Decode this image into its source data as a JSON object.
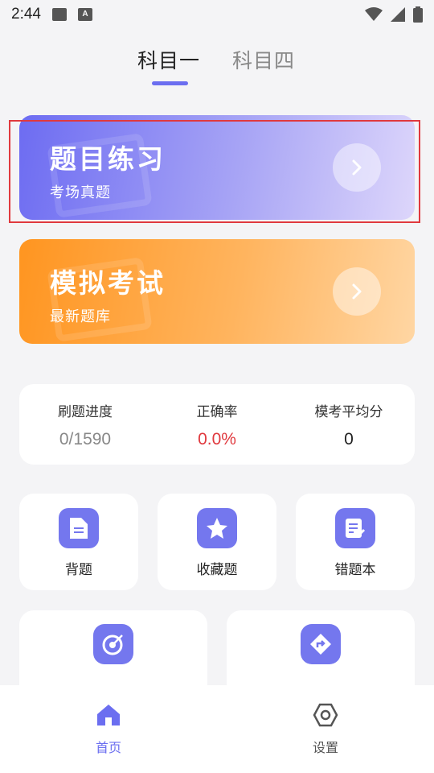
{
  "status_bar": {
    "time": "2:44"
  },
  "subject_tabs": [
    {
      "label": "科目一",
      "active": true
    },
    {
      "label": "科目四",
      "active": false
    }
  ],
  "practice_card": {
    "title": "题目练习",
    "subtitle": "考场真题"
  },
  "mock_card": {
    "title": "模拟考试",
    "subtitle": "最新题库"
  },
  "stats": [
    {
      "label": "刷题进度",
      "value": "0/1590",
      "color": "#888888"
    },
    {
      "label": "正确率",
      "value": "0.0%",
      "color": "#e0393e"
    },
    {
      "label": "模考平均分",
      "value": "0",
      "color": "#222222"
    }
  ],
  "features": [
    {
      "label": "背题",
      "icon": "document-icon"
    },
    {
      "label": "收藏题",
      "icon": "star-icon"
    },
    {
      "label": "错题本",
      "icon": "edit-list-icon"
    }
  ],
  "extra_features": [
    {
      "icon": "target-icon"
    },
    {
      "icon": "turn-right-sign-icon"
    }
  ],
  "bottom_nav": [
    {
      "label": "首页",
      "icon": "home-icon",
      "active": true
    },
    {
      "label": "设置",
      "icon": "settings-hex-icon",
      "active": false
    }
  ],
  "colors": {
    "accent": "#6b6ef0",
    "practice_gradient_start": "#6d6cf2",
    "mock_gradient_start": "#ff9520",
    "error_red": "#e0393e"
  }
}
